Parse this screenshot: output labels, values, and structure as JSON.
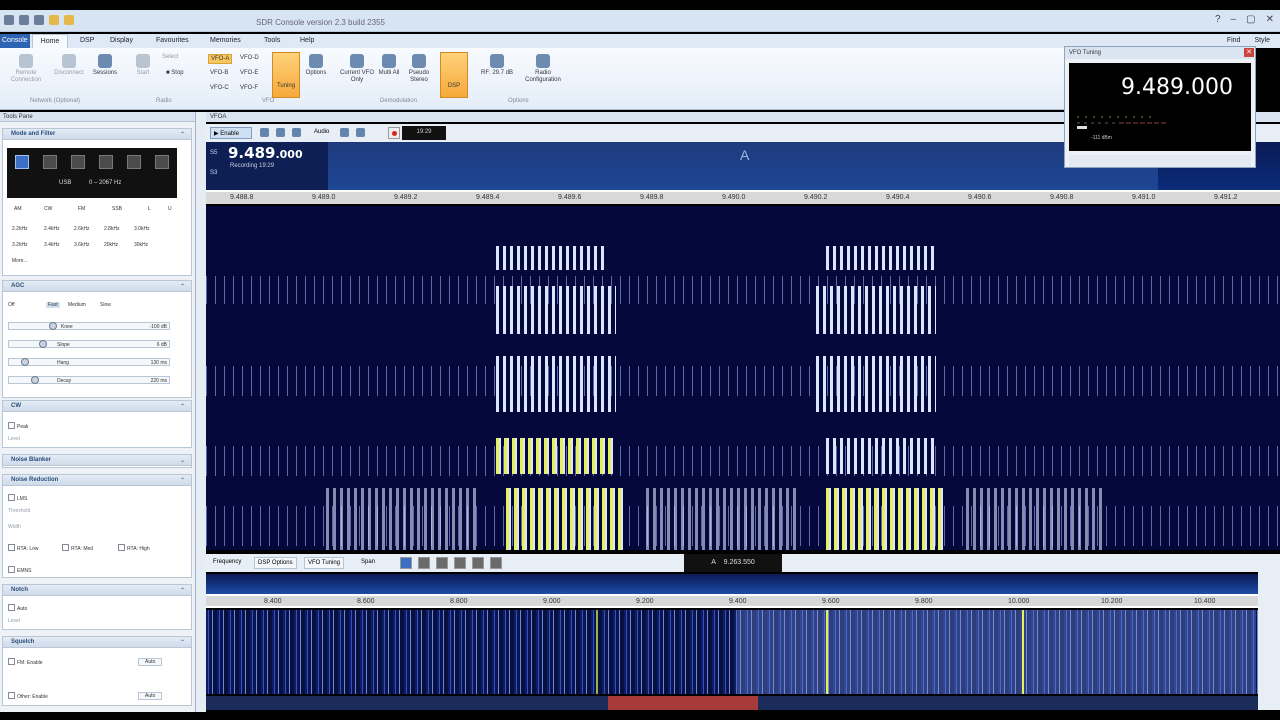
{
  "window": {
    "title": "SDR Console version 2.3 build 2355",
    "controls": [
      "?",
      "–",
      "▢",
      "✕"
    ]
  },
  "ribbon": {
    "app_button": "Console",
    "tabs": [
      "Home",
      "DSP",
      "Display",
      "Favourites",
      "Memories",
      "Tools",
      "Help"
    ],
    "right_tools": [
      "Find",
      "Style"
    ],
    "buttons": {
      "remote_connection": "Remote Connection",
      "disconnect": "Disconnect",
      "sessions": "Sessions",
      "start": "Start",
      "select": "Select",
      "stop": "Stop",
      "vfo_a": "VFO-A",
      "vfo_b": "VFO-B",
      "vfo_c": "VFO-C",
      "vfo_d": "VFO-D",
      "vfo_e": "VFO-E",
      "vfo_f": "VFO-F",
      "tuning": "Tuning",
      "options": "Options",
      "current_vfo_only": "Current VFO Only",
      "multi_all": "Multi All",
      "pseudo_stereo": "Pseudo Stereo",
      "dsp": "DSP",
      "rf": "RF: 29.7 dB",
      "radio_config": "Radio Configuration"
    },
    "groups": {
      "network": "Network (Optional)",
      "radio": "Radio",
      "vfo": "VFO",
      "demodulation": "Demodulation",
      "options": "Options"
    }
  },
  "tools_pane": {
    "title": "Tools Pane",
    "mode_filter": {
      "title": "Mode and Filter",
      "mode": "USB",
      "range": "0 – 2067 Hz",
      "selectors": [
        "AM",
        "CW",
        "FM",
        "SSB",
        "L",
        "U"
      ],
      "filters_row1": [
        "2.2kHz",
        "2.4kHz",
        "2.6kHz",
        "2.8kHz",
        "3.0kHz"
      ],
      "filters_row2": [
        "3.2kHz",
        "3.4kHz",
        "3.6kHz",
        "20kHz",
        "30kHz"
      ],
      "more": "More..."
    },
    "agc": {
      "title": "AGC",
      "options": [
        "Off",
        "Fast",
        "Medium",
        "Slow"
      ],
      "knee": {
        "label": "Knee",
        "value": "-100 dB"
      },
      "slope": {
        "label": "Slope",
        "value": "6 dB"
      },
      "hang": {
        "label": "Hang",
        "value": "130 ms"
      },
      "decay": {
        "label": "Decay",
        "value": "220 ms"
      }
    },
    "cw": {
      "title": "CW",
      "peak": "Peak",
      "level": "Level"
    },
    "noise_blanker": {
      "title": "Noise Blanker"
    },
    "noise_reduction": {
      "title": "Noise Reduction",
      "lms": "LMS",
      "threshold": "Threshold",
      "width": "Width",
      "rta_low": "RTA: Low",
      "rta_med": "RTA: Med",
      "rta_high": "RTA: High",
      "emns": "EMNS"
    },
    "notch": {
      "title": "Notch",
      "auto": "Auto",
      "level": "Level"
    },
    "squelch": {
      "title": "Squelch",
      "fm_enable": "FM: Enable",
      "other_enable": "Other: Enable",
      "auto": "Auto"
    }
  },
  "vfo_panel": {
    "title": "VFOA",
    "enable": "Enable",
    "audio": "Audio",
    "time": "19:29",
    "freq_main": "9.489",
    "freq_dec": ".000",
    "recording": "Recording 19:29",
    "s_labels": [
      "S5",
      "S3"
    ],
    "a_marker": "A",
    "scale": [
      "9.488.8",
      "9.489.0",
      "9.489.2",
      "9.489.4",
      "9.489.6",
      "9.489.8",
      "9.490.0",
      "9.490.2",
      "9.490.4",
      "9.490.6",
      "9.490.8",
      "9.491.0",
      "9.491.2"
    ]
  },
  "bottom": {
    "tabs": [
      "Frequency",
      "DSP Options",
      "VFO Tuning"
    ],
    "span": "Span",
    "freq_label": "A",
    "freq_value": "9.263.550",
    "scale": [
      "8.400",
      "8.600",
      "8.800",
      "9.000",
      "9.200",
      "9.400",
      "9.600",
      "9.800",
      "10.000",
      "10.200",
      "10.400"
    ]
  },
  "vfo_tuning": {
    "title": "VFO Tuning",
    "freq": "9.489.000",
    "dbm": "-111 dBm"
  }
}
